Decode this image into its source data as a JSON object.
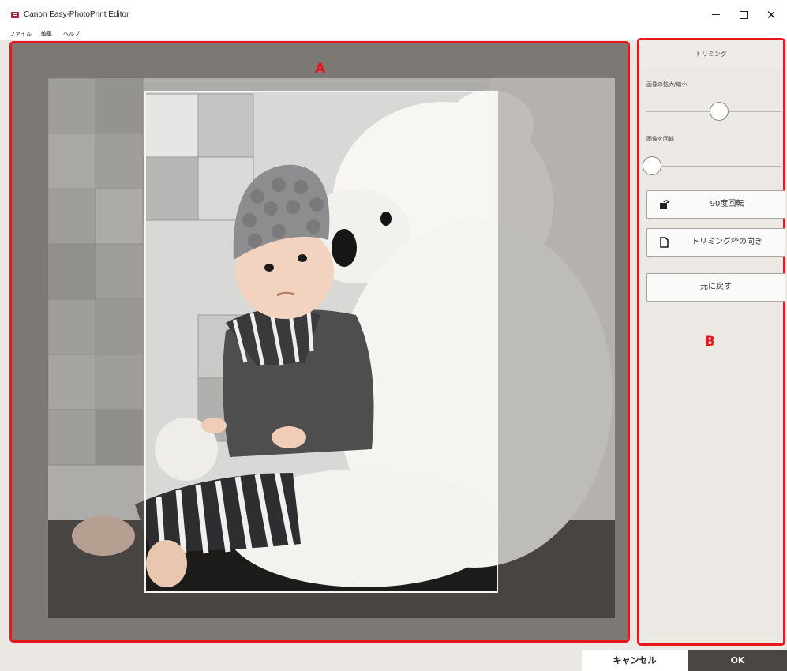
{
  "window": {
    "title": "Canon Easy-PhotoPrint Editor",
    "controls": {
      "minimize": "–",
      "maximize": "□",
      "close": "✕"
    }
  },
  "menu": [
    "ファイル",
    "編集",
    "ヘルプ"
  ],
  "annotations": {
    "preview_label": "A",
    "panel_label": "B"
  },
  "panel": {
    "title": "トリミング",
    "zoom": {
      "label": "画像の拡大/縮小",
      "value_percent": 54
    },
    "rotate": {
      "label": "画像を回転",
      "value_percent": 4
    },
    "rotate90": {
      "label": "90度回転",
      "icon": "rotate-90-icon"
    },
    "orientation": {
      "label": "トリミング枠の向き",
      "icon": "page-orientation-icon"
    },
    "reset": {
      "label": "元に戻す"
    }
  },
  "footer": {
    "cancel": "キャンセル",
    "ok": "OK"
  },
  "colors": {
    "annotation": "#e8161d",
    "ok_button": "#4a4644",
    "panel_bg": "#ece9e4",
    "preview_bg": "#7c7874"
  }
}
